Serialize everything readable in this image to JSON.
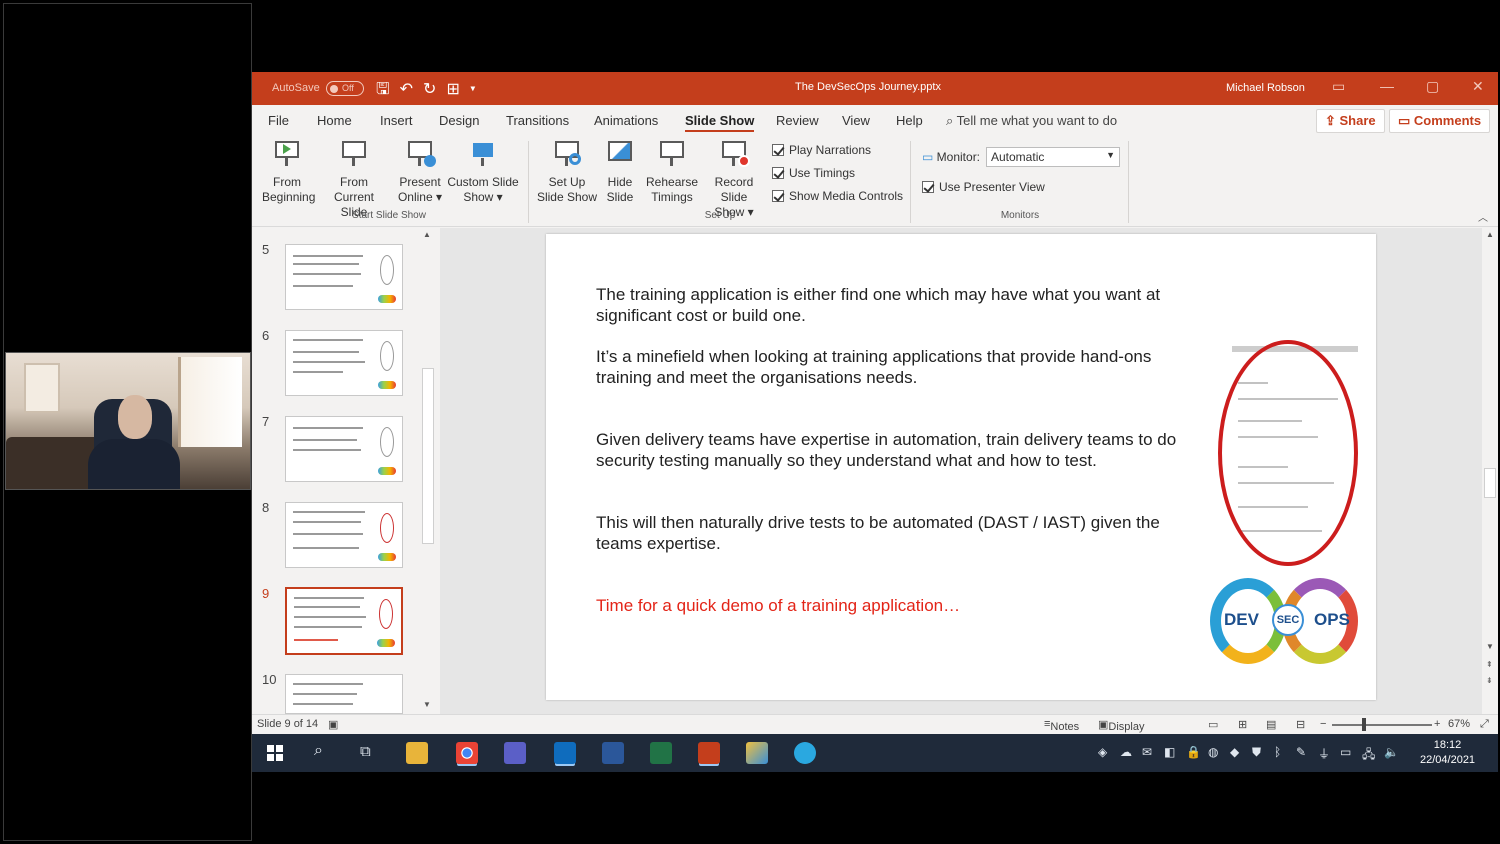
{
  "window": {
    "autosave_label": "AutoSave",
    "autosave_state": "Off",
    "title": "The DevSecOps Journey.pptx",
    "user": "Michael Robson"
  },
  "tabs": [
    "File",
    "Home",
    "Insert",
    "Design",
    "Transitions",
    "Animations",
    "Slide Show",
    "Review",
    "View",
    "Help"
  ],
  "active_tab": "Slide Show",
  "tell_me": "Tell me what you want to do",
  "share_label": "Share",
  "comments_label": "Comments",
  "ribbon": {
    "from_beginning": [
      "From",
      "Beginning"
    ],
    "from_current": [
      "From",
      "Current Slide"
    ],
    "present_online": [
      "Present",
      "Online ▾"
    ],
    "custom_show": [
      "Custom Slide",
      "Show ▾"
    ],
    "group_start": "Start Slide Show",
    "setup_show": [
      "Set Up",
      "Slide Show"
    ],
    "hide_slide": [
      "Hide",
      "Slide"
    ],
    "rehearse": [
      "Rehearse",
      "Timings"
    ],
    "record": [
      "Record Slide",
      "Show ▾"
    ],
    "play_narrations": "Play Narrations",
    "use_timings": "Use Timings",
    "show_media": "Show Media Controls",
    "group_setup": "Set Up",
    "monitor_label": "Monitor:",
    "monitor_value": "Automatic",
    "presenter_view": "Use Presenter View",
    "group_monitors": "Monitors"
  },
  "thumbnails": [
    "5",
    "6",
    "7",
    "8",
    "9",
    "10"
  ],
  "selected_slide": "9",
  "slide": {
    "p1": "The training application is either find one which may have what you want at significant cost or build one.",
    "p2": "It’s a minefield when looking at training applications that provide hand-ons training and meet the organisations needs.",
    "p3": "Given delivery teams have expertise in automation, train delivery teams to do security testing manually so they understand what and how to test.",
    "p4": "This will then naturally drive tests to be automated (DAST / IAST) given the teams expertise.",
    "p5": "Time for a quick demo of a training application…",
    "logo_left": "DEV",
    "logo_mid": "SEC",
    "logo_right": "OPS"
  },
  "status": {
    "slide_counter": "Slide 9 of 14",
    "notes": "Notes",
    "display_settings": "Display Settings",
    "zoom": "67%"
  },
  "taskbar": {
    "time": "18:12",
    "date": "22/04/2021"
  },
  "colors": {
    "ppt_accent": "#c43e1c",
    "slide_red_text": "#e32417",
    "taskbar": "#1f2a3a"
  }
}
